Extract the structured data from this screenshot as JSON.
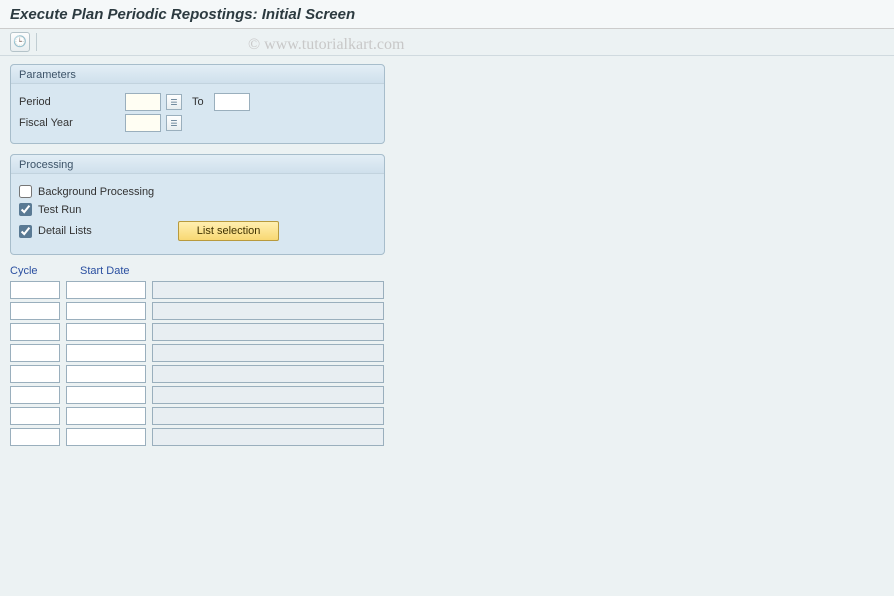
{
  "title": "Execute Plan Periodic Repostings: Initial Screen",
  "watermark": "© www.tutorialkart.com",
  "toolbar": {
    "execute_title": "Execute"
  },
  "parameters": {
    "legend": "Parameters",
    "period_label": "Period",
    "to_label": "To",
    "fiscal_year_label": "Fiscal Year",
    "period_from": "",
    "period_to": "",
    "fiscal_year": ""
  },
  "processing": {
    "legend": "Processing",
    "background_label": "Background Processing",
    "testrun_label": "Test Run",
    "detail_label": "Detail Lists",
    "background_checked": false,
    "testrun_checked": true,
    "detail_checked": true,
    "list_selection_label": "List selection"
  },
  "columns": {
    "cycle": "Cycle",
    "start_date": "Start Date"
  },
  "rows": [
    {
      "cycle": "",
      "start": "",
      "desc": ""
    },
    {
      "cycle": "",
      "start": "",
      "desc": ""
    },
    {
      "cycle": "",
      "start": "",
      "desc": ""
    },
    {
      "cycle": "",
      "start": "",
      "desc": ""
    },
    {
      "cycle": "",
      "start": "",
      "desc": ""
    },
    {
      "cycle": "",
      "start": "",
      "desc": ""
    },
    {
      "cycle": "",
      "start": "",
      "desc": ""
    },
    {
      "cycle": "",
      "start": "",
      "desc": ""
    }
  ]
}
